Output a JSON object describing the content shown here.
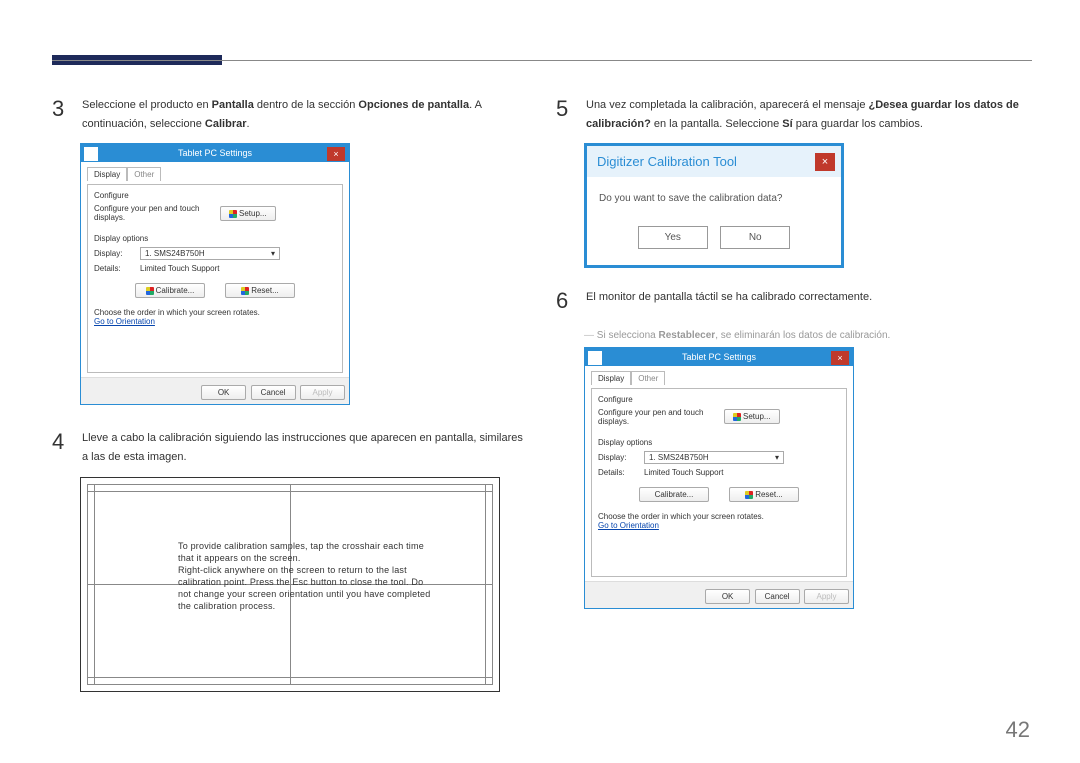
{
  "page_number": "42",
  "step3": {
    "num": "3",
    "text_a": "Seleccione el producto en ",
    "bold_a": "Pantalla",
    "text_b": " dentro de la sección ",
    "bold_b": "Opciones de pantalla",
    "text_c": ". A continuación, seleccione ",
    "bold_c": "Calibrar",
    "text_d": "."
  },
  "step4": {
    "num": "4",
    "text": "Lleve a cabo la calibración siguiendo las instrucciones que aparecen en pantalla, similares a las de esta imagen."
  },
  "step5": {
    "num": "5",
    "text_a": "Una vez completada la calibración, aparecerá el mensaje ",
    "bold_a": "¿Desea guardar los datos de calibración?",
    "text_b": " en la pantalla. Seleccione ",
    "bold_b": "Sí",
    "text_c": " para guardar los cambios."
  },
  "step6": {
    "num": "6",
    "text": "El monitor de pantalla táctil se ha calibrado correctamente."
  },
  "note6": {
    "text_a": "Si selecciona ",
    "bold_a": "Restablecer",
    "text_b": ", se eliminarán los datos de calibración."
  },
  "tablet_win": {
    "title": "Tablet PC Settings",
    "tabs": [
      "Display",
      "Other"
    ],
    "configure_label": "Configure",
    "configure_text": "Configure your pen and touch displays.",
    "setup_btn": "Setup...",
    "display_options": "Display options",
    "display_label": "Display:",
    "display_value": "1. SMS24B750H",
    "details_label": "Details:",
    "details_value": "Limited Touch Support",
    "calibrate_btn": "Calibrate...",
    "reset_btn": "Reset...",
    "rotation_text": "Choose the order in which your screen rotates.",
    "orientation_link": "Go to Orientation",
    "ok": "OK",
    "cancel": "Cancel",
    "apply": "Apply"
  },
  "cal_text": "To provide calibration samples, tap the crosshair each time that it appears on the screen.\nRight-click anywhere on the screen to return to the last calibration point. Press the Esc button to close the tool. Do not change your screen orientation until you have completed the calibration process.",
  "dialog": {
    "title": "Digitizer Calibration Tool",
    "message": "Do you want to save the calibration data?",
    "yes": "Yes",
    "no": "No"
  }
}
